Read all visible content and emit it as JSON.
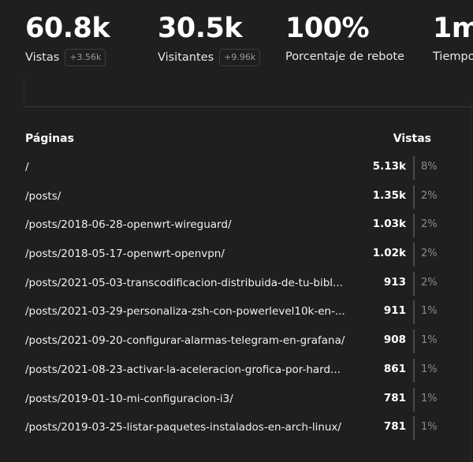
{
  "metrics": [
    {
      "value": "60.8k",
      "label": "Vistas",
      "change": "+3.56k"
    },
    {
      "value": "30.5k",
      "label": "Visitantes",
      "change": "+9.96k"
    },
    {
      "value": "100%",
      "label": "Porcentaje de rebote",
      "change": ""
    },
    {
      "value": "1m",
      "label": "Tiempo",
      "change": ""
    }
  ],
  "pages_panel": {
    "title": "Páginas",
    "metric_title": "Vistas",
    "rows": [
      {
        "path": "/",
        "count": "5.13k",
        "percent": "8%"
      },
      {
        "path": "/posts/",
        "count": "1.35k",
        "percent": "2%"
      },
      {
        "path": "/posts/2018-06-28-openwrt-wireguard/",
        "count": "1.03k",
        "percent": "2%"
      },
      {
        "path": "/posts/2018-05-17-openwrt-openvpn/",
        "count": "1.02k",
        "percent": "2%"
      },
      {
        "path": "/posts/2021-05-03-transcodificacion-distribuida-de-tu-bibl...",
        "count": "913",
        "percent": "2%"
      },
      {
        "path": "/posts/2021-03-29-personaliza-zsh-con-powerlevel10k-en-...",
        "count": "911",
        "percent": "1%"
      },
      {
        "path": "/posts/2021-09-20-configurar-alarmas-telegram-en-grafana/",
        "count": "908",
        "percent": "1%"
      },
      {
        "path": "/posts/2021-08-23-activar-la-aceleracion-grofica-por-hard...",
        "count": "861",
        "percent": "1%"
      },
      {
        "path": "/posts/2019-01-10-mi-configuracion-i3/",
        "count": "781",
        "percent": "1%"
      },
      {
        "path": "/posts/2019-03-25-listar-paquetes-instalados-en-arch-linux/",
        "count": "781",
        "percent": "1%"
      }
    ]
  }
}
